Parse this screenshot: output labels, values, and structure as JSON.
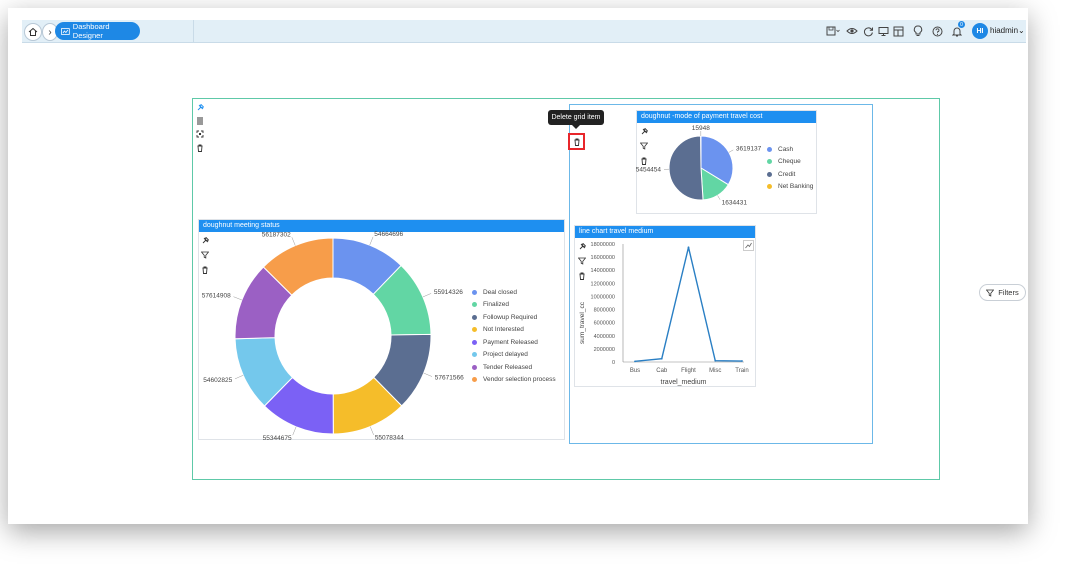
{
  "breadcrumb": {
    "current": "Dashboard Designer"
  },
  "user": {
    "initials": "HI",
    "name": "hiadmin",
    "notifications": "0"
  },
  "tooltip": {
    "text": "Delete grid item"
  },
  "filters": {
    "label": "Filters"
  },
  "meeting_card": {
    "title": "doughnut meeting status"
  },
  "payment_card": {
    "title": "doughnut -mode of payment travel cost"
  },
  "line_card": {
    "title": "line chart travel medium"
  },
  "colors": {
    "accent": "#1e8ff0",
    "outer_grid": "#5ec9a8",
    "inner_grid": "#6cb8e8",
    "delete_highlight": "#e8262b"
  },
  "chart_data": [
    {
      "type": "pie",
      "variant": "doughnut",
      "title": "doughnut meeting status",
      "categories": [
        "Deal closed",
        "Finalized",
        "Followup Required",
        "Not Interested",
        "Payment Released",
        "Project delayed",
        "Tender Released",
        "Vendor selection process"
      ],
      "values": [
        54664696,
        55914326,
        57671566,
        55078344,
        55344675,
        54602825,
        57614908,
        56187302
      ],
      "colors": [
        "#6b93ef",
        "#62d6a4",
        "#5b6e91",
        "#f5bd2a",
        "#7b61f5",
        "#74c8ec",
        "#9b60c4",
        "#f79d4a"
      ],
      "legend": "right"
    },
    {
      "type": "pie",
      "title": "doughnut -mode of payment travel cost",
      "categories": [
        "Cash",
        "Cheque",
        "Credit",
        "Net Banking"
      ],
      "values": [
        3619137,
        1634431,
        5454454,
        15948
      ],
      "labels": [
        "3619137",
        "1634431",
        "5454454",
        "15948"
      ],
      "colors": [
        "#6b93ef",
        "#62d6a4",
        "#5b6e91",
        "#f5bd2a"
      ],
      "legend": "right"
    },
    {
      "type": "line",
      "title": "line chart travel medium",
      "categories": [
        "Bus",
        "Cab",
        "Flight",
        "Misc",
        "Train"
      ],
      "values": [
        100000,
        500000,
        17500000,
        200000,
        150000
      ],
      "xlabel": "travel_medium",
      "ylabel": "sum_travel_cc",
      "ylim": [
        0,
        18000000
      ],
      "yticks": [
        "0",
        "2000000",
        "4000000",
        "6000000",
        "8000000",
        "10000000",
        "12000000",
        "14000000",
        "16000000",
        "18000000"
      ],
      "color": "#2a7fc4"
    }
  ]
}
